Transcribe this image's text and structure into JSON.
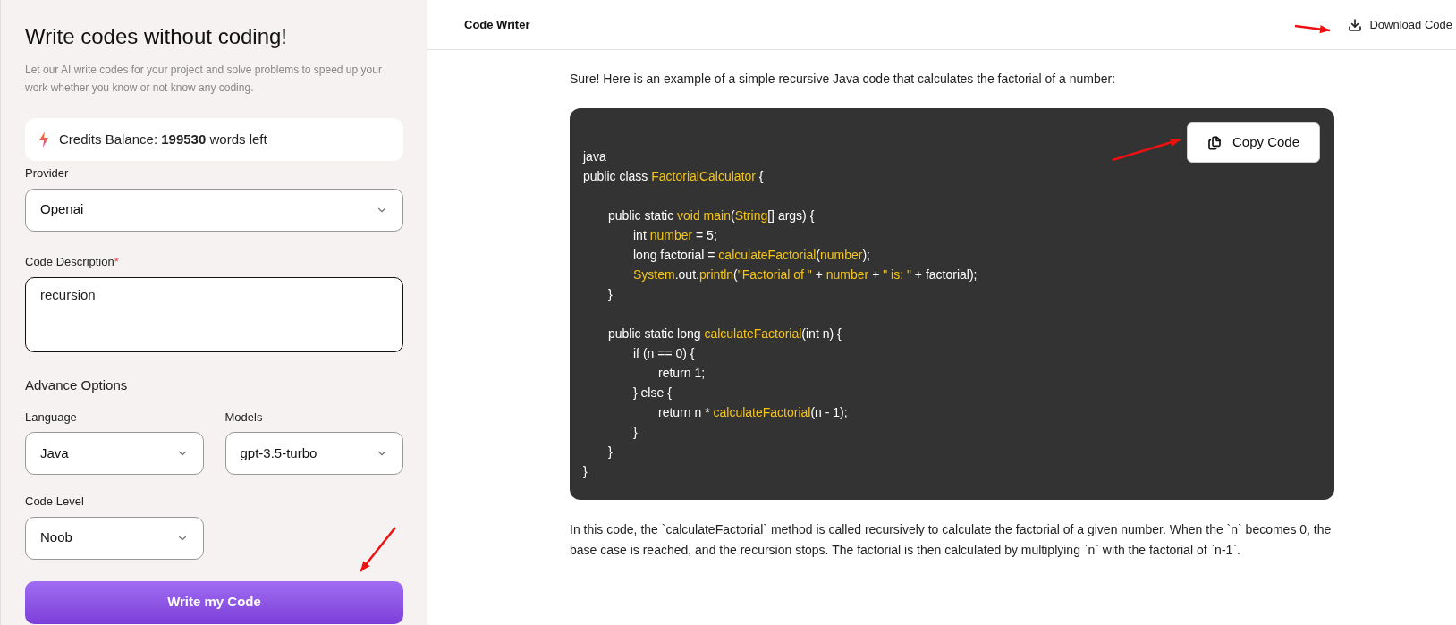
{
  "sidebar": {
    "title": "Write codes without coding!",
    "subtitle": "Let our AI write codes for your project and solve problems to speed up your work whether you know or not know any coding.",
    "credits": {
      "label": "Credits Balance:",
      "amount": "199530",
      "suffix": "words left"
    },
    "provider": {
      "label": "Provider",
      "value": "Openai"
    },
    "description": {
      "label": "Code Description",
      "required_mark": "*",
      "value": "recursion"
    },
    "advance_title": "Advance Options",
    "language": {
      "label": "Language",
      "value": "Java"
    },
    "models": {
      "label": "Models",
      "value": "gpt-3.5-turbo"
    },
    "code_level": {
      "label": "Code Level",
      "value": "Noob"
    },
    "submit": "Write my Code"
  },
  "header": {
    "title": "Code Writer",
    "download": "Download Code"
  },
  "intro": "Sure! Here is an example of a simple recursive Java code that calculates the factorial of a number:",
  "code_block": {
    "copy_button": "Copy Code",
    "lines": [
      {
        "kind": "code",
        "segments": [
          {
            "text": "java",
            "highlight": false
          }
        ]
      },
      {
        "kind": "code",
        "segments": [
          {
            "text": "public class ",
            "highlight": false
          },
          {
            "text": "FactorialCalculator",
            "highlight": true
          },
          {
            "text": " {",
            "highlight": false
          }
        ],
        "children": [
          {
            "kind": "blank"
          },
          {
            "kind": "code",
            "segments": [
              {
                "text": "public static ",
                "highlight": false
              },
              {
                "text": "void main",
                "highlight": true
              },
              {
                "text": "(",
                "highlight": false
              },
              {
                "text": "String",
                "highlight": true
              },
              {
                "text": "[] args) {",
                "highlight": false
              }
            ],
            "children": [
              {
                "kind": "code",
                "segments": [
                  {
                    "text": "int ",
                    "highlight": false
                  },
                  {
                    "text": "number",
                    "highlight": true
                  },
                  {
                    "text": " = 5;",
                    "highlight": false
                  }
                ]
              },
              {
                "kind": "code",
                "segments": [
                  {
                    "text": "long factorial = ",
                    "highlight": false
                  },
                  {
                    "text": "calculateFactorial",
                    "highlight": true
                  },
                  {
                    "text": "(",
                    "highlight": false
                  },
                  {
                    "text": "number",
                    "highlight": true
                  },
                  {
                    "text": ");",
                    "highlight": false
                  }
                ]
              },
              {
                "kind": "code",
                "segments": [
                  {
                    "text": "System",
                    "highlight": true
                  },
                  {
                    "text": ".out.",
                    "highlight": false
                  },
                  {
                    "text": "println",
                    "highlight": true
                  },
                  {
                    "text": "(",
                    "highlight": false
                  },
                  {
                    "text": "\"Factorial of \"",
                    "highlight": true
                  },
                  {
                    "text": " + ",
                    "highlight": false
                  },
                  {
                    "text": "number",
                    "highlight": true
                  },
                  {
                    "text": " + ",
                    "highlight": false
                  },
                  {
                    "text": "\" is: \"",
                    "highlight": true
                  },
                  {
                    "text": " + factorial);",
                    "highlight": false
                  }
                ]
              }
            ]
          },
          {
            "kind": "code",
            "segments": [
              {
                "text": "}",
                "highlight": false
              }
            ]
          },
          {
            "kind": "blank"
          },
          {
            "kind": "code",
            "segments": [
              {
                "text": "public static long ",
                "highlight": false
              },
              {
                "text": "calculateFactorial",
                "highlight": true
              },
              {
                "text": "(int n) {",
                "highlight": false
              }
            ],
            "children": [
              {
                "kind": "code",
                "segments": [
                  {
                    "text": "if (n == 0) {",
                    "highlight": false
                  }
                ],
                "children": [
                  {
                    "kind": "code",
                    "segments": [
                      {
                        "text": "return 1;",
                        "highlight": false
                      }
                    ]
                  }
                ]
              },
              {
                "kind": "code",
                "segments": [
                  {
                    "text": "} else {",
                    "highlight": false
                  }
                ],
                "children": [
                  {
                    "kind": "code",
                    "segments": [
                      {
                        "text": "return n * ",
                        "highlight": false
                      },
                      {
                        "text": "calculateFactorial",
                        "highlight": true
                      },
                      {
                        "text": "(n - 1);",
                        "highlight": false
                      }
                    ]
                  }
                ]
              },
              {
                "kind": "code",
                "segments": [
                  {
                    "text": "}",
                    "highlight": false
                  }
                ]
              }
            ]
          },
          {
            "kind": "code",
            "segments": [
              {
                "text": "}",
                "highlight": false
              }
            ]
          }
        ]
      },
      {
        "kind": "code",
        "segments": [
          {
            "text": "}",
            "highlight": false
          }
        ]
      }
    ]
  },
  "explanation": "In this code, the `calculateFactorial` method is called recursively to calculate the factorial of a given number. When the `n` becomes 0, the base case is reached, and the recursion stops. The factorial is then calculated by multiplying `n` with the factorial of `n-1`."
}
